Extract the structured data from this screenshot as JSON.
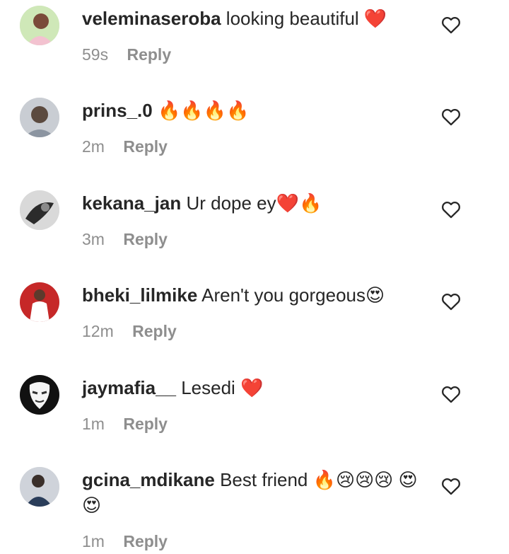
{
  "comments": [
    {
      "username": "veleminaseroba",
      "text": "looking beautiful ❤️",
      "time": "59s",
      "reply_label": "Reply",
      "avatar_colors": [
        "#f3c2d0",
        "#7a4b3a",
        "#b7dba0"
      ]
    },
    {
      "username": "prins_.0",
      "text": "🔥🔥🔥🔥",
      "time": "2m",
      "reply_label": "Reply",
      "avatar_colors": [
        "#c9cdd3",
        "#5b4a3f",
        "#8c95a1"
      ]
    },
    {
      "username": "kekana_jan",
      "text": "Ur dope ey❤️🔥",
      "time": "3m",
      "reply_label": "Reply",
      "avatar_colors": [
        "#d9d9d9",
        "#2b2b2b",
        "#8a8a8a"
      ]
    },
    {
      "username": "bheki_lilmike",
      "text": "Aren't you gorgeous😍",
      "time": "12m",
      "reply_label": "Reply",
      "avatar_colors": [
        "#c62828",
        "#5d3a2c",
        "#ffffff"
      ]
    },
    {
      "username": "jaymafia__",
      "text": "Lesedi ❤️",
      "time": "1m",
      "reply_label": "Reply",
      "avatar_colors": [
        "#111111",
        "#f5f5f5",
        "#333333"
      ]
    },
    {
      "username": "gcina_mdikane",
      "text": "Best friend 🔥😢😢😢 😍😍",
      "time": "1m",
      "reply_label": "Reply",
      "avatar_colors": [
        "#cfd3da",
        "#3a2f2a",
        "#2a3d5a"
      ]
    }
  ],
  "icons": {
    "like": "heart-outline-icon"
  }
}
